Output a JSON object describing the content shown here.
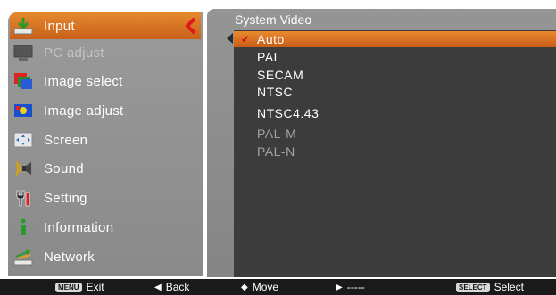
{
  "menu": {
    "items": [
      {
        "label": "Input",
        "icon": "input-icon",
        "state": "selected"
      },
      {
        "label": "PC adjust",
        "icon": "pc-adjust-icon",
        "state": "disabled"
      },
      {
        "label": "Image select",
        "icon": "image-select-icon",
        "state": "normal"
      },
      {
        "label": "Image adjust",
        "icon": "image-adjust-icon",
        "state": "normal"
      },
      {
        "label": "Screen",
        "icon": "screen-icon",
        "state": "normal"
      },
      {
        "label": "Sound",
        "icon": "sound-icon",
        "state": "normal"
      },
      {
        "label": "Setting",
        "icon": "setting-icon",
        "state": "normal"
      },
      {
        "label": "Information",
        "icon": "information-icon",
        "state": "normal"
      },
      {
        "label": "Network",
        "icon": "network-icon",
        "state": "normal"
      }
    ]
  },
  "submenu": {
    "title": "System Video",
    "options": [
      {
        "label": "Auto",
        "state": "selected",
        "checked": true
      },
      {
        "label": "PAL",
        "state": "normal"
      },
      {
        "label": "SECAM",
        "state": "normal"
      },
      {
        "label": "NTSC",
        "state": "normal"
      },
      {
        "label": "NTSC4.43",
        "state": "normal"
      },
      {
        "label": "PAL-M",
        "state": "disabled"
      },
      {
        "label": "PAL-N",
        "state": "disabled"
      }
    ]
  },
  "footer": {
    "exit": {
      "key": "MENU",
      "label": "Exit"
    },
    "back": {
      "glyph": "◀",
      "label": "Back"
    },
    "move": {
      "glyph": "◆",
      "label": "Move"
    },
    "next": {
      "glyph": "▶",
      "label": "-----"
    },
    "select": {
      "key": "SELECT",
      "label": "Select"
    }
  },
  "colors": {
    "accent": "#d8701f",
    "check": "#cc1010",
    "panel": "#8f8f8f",
    "list_bg": "#3c3c3c"
  }
}
